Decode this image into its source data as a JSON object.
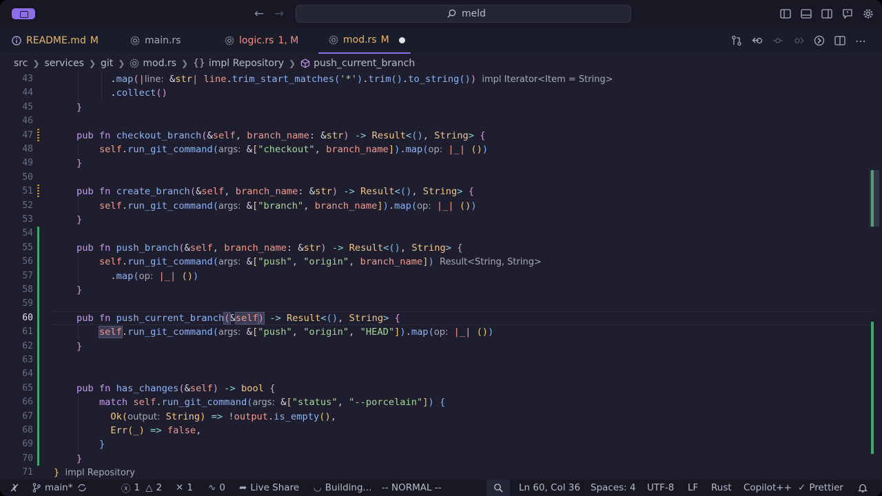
{
  "titlebar": {
    "search_text": "meld"
  },
  "tabs": [
    {
      "label": "README.md",
      "badge": "M",
      "kind": "info"
    },
    {
      "label": "main.rs",
      "badge": "",
      "kind": "rust"
    },
    {
      "label": "logic.rs",
      "badge": "1, M",
      "kind": "rust"
    },
    {
      "label": "mod.rs",
      "badge": "M",
      "kind": "rust",
      "active": true,
      "dirty": true
    }
  ],
  "breadcrumb": [
    "src",
    "services",
    "git",
    "mod.rs",
    "impl Repository",
    "push_current_branch"
  ],
  "breadcrumb_icons": {
    "file": "rust-file-icon",
    "impl": "braces-icon",
    "method": "method-cube-icon"
  },
  "editor": {
    "current_line": 60,
    "lines": [
      "43",
      "44",
      "45",
      "46",
      "47",
      "48",
      "49",
      "50",
      "51",
      "52",
      "53",
      "54",
      "55",
      "56",
      "57",
      "58",
      "59",
      "60",
      "61",
      "62",
      "63",
      "64",
      "65",
      "66",
      "67",
      "68",
      "69",
      "70",
      "71"
    ],
    "hints": {
      "h43": "impl Iterator<Item = String>",
      "h56": "Result<String, String>",
      "line": "line:",
      "args": "args:",
      "op": "op:",
      "output": "output:"
    }
  },
  "status": {
    "branch": "main*",
    "errors": "1",
    "warnings": "2",
    "tools": "1",
    "ports": "0",
    "live_share": "Live Share",
    "building": "Building...",
    "mode": "-- NORMAL --",
    "position": "Ln 60, Col 36",
    "spaces": "Spaces: 4",
    "encoding": "UTF-8",
    "eol": "LF",
    "language": "Rust",
    "copilot": "Copilot++",
    "prettier": "Prettier"
  },
  "colors": {
    "accent": "#8b6ee8",
    "git_added": "#3fa86b",
    "git_modified": "#b78c43"
  }
}
